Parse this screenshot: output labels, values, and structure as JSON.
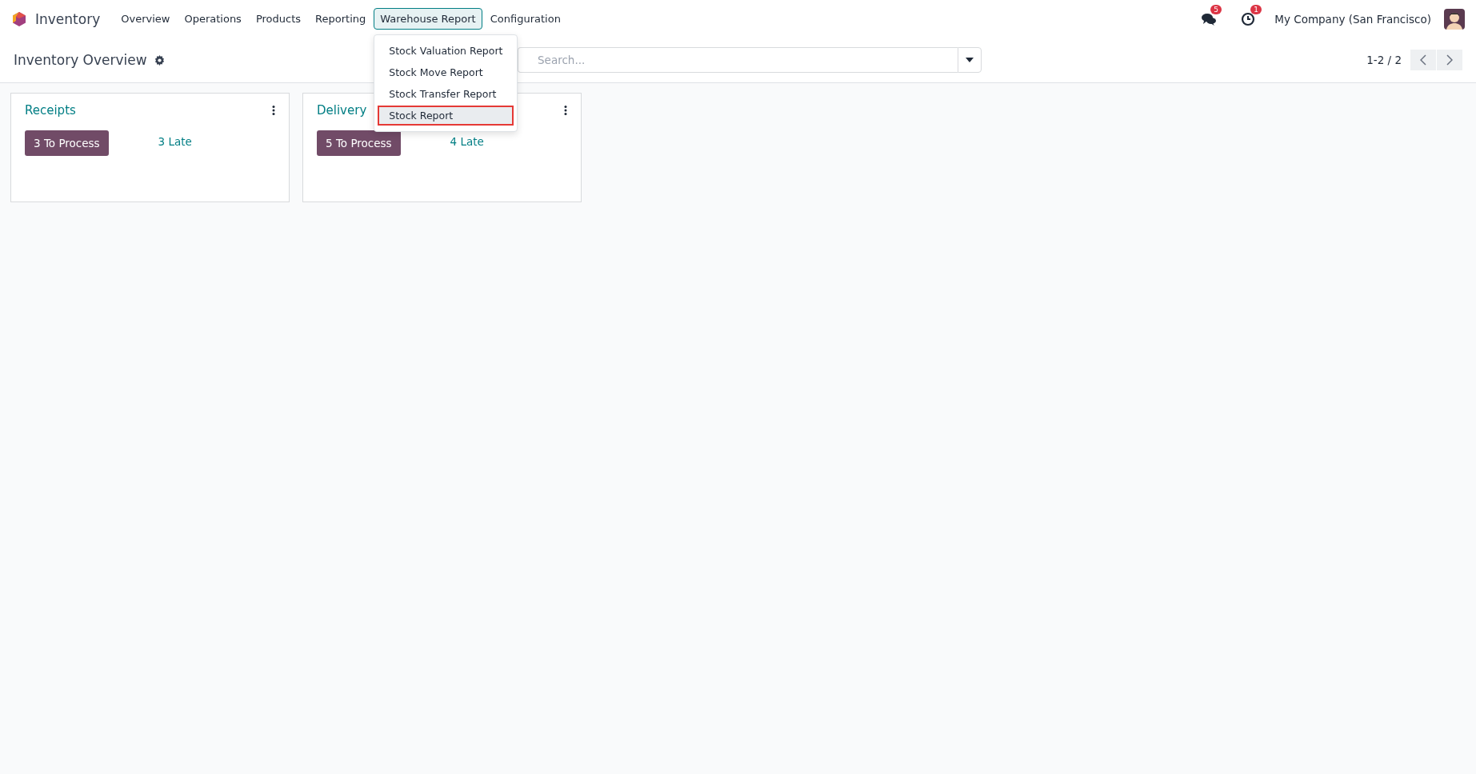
{
  "app": {
    "name": "Inventory"
  },
  "menu": [
    {
      "label": "Overview",
      "selected": false
    },
    {
      "label": "Operations",
      "selected": false
    },
    {
      "label": "Products",
      "selected": false
    },
    {
      "label": "Reporting",
      "selected": false
    },
    {
      "label": "Warehouse Report",
      "selected": true,
      "items": [
        {
          "label": "Stock Valuation Report",
          "highlighted": false
        },
        {
          "label": "Stock Move Report",
          "highlighted": false
        },
        {
          "label": "Stock Transfer Report",
          "highlighted": false
        },
        {
          "label": "Stock Report",
          "highlighted": true
        }
      ]
    },
    {
      "label": "Configuration",
      "selected": false
    }
  ],
  "systray": {
    "messages_badge": "5",
    "activities_badge": "1",
    "company": "My Company (San Francisco)"
  },
  "control_panel": {
    "title": "Inventory Overview",
    "search": {
      "placeholder": "Search..."
    },
    "pager": "1-2 / 2"
  },
  "cards": [
    {
      "title": "Receipts",
      "button": "3 To Process",
      "late": "3 Late"
    },
    {
      "title": "Delivery",
      "button": "5 To Process",
      "late": "4 Late"
    }
  ]
}
